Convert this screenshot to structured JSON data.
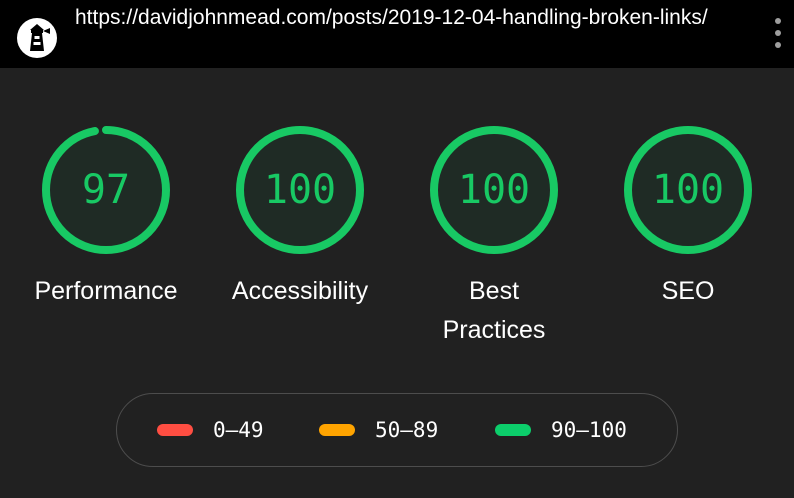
{
  "header": {
    "url": "https://davidjohnmead.com/posts/2019-12-04-handling-broken-links/",
    "logo_icon": "lighthouse-icon",
    "menu_icon": "more-vert-icon"
  },
  "gauges": [
    {
      "label": "Performance",
      "score": 97,
      "display": "97"
    },
    {
      "label": "Accessibility",
      "score": 100,
      "display": "100"
    },
    {
      "label": "Best Practices",
      "score": 100,
      "display": "100"
    },
    {
      "label": "SEO",
      "score": 100,
      "display": "100"
    }
  ],
  "legend": [
    {
      "range": "0–49",
      "color": "#ff4e42"
    },
    {
      "range": "50–89",
      "color": "#ffa400"
    },
    {
      "range": "90–100",
      "color": "#0cce6b"
    }
  ],
  "colors": {
    "background": "#212121",
    "topbar": "#000000",
    "pass": "#18c964"
  }
}
